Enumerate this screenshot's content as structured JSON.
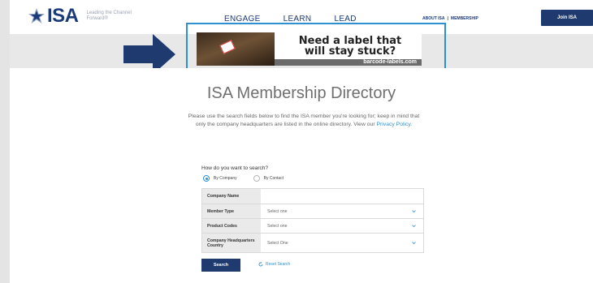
{
  "header": {
    "logo_text": "ISA",
    "tagline": "Leading the Channel Forward®",
    "nav": [
      "ENGAGE",
      "LEARN",
      "LEAD"
    ],
    "util_about": "ABOUT ISA",
    "util_sep": "|",
    "util_membership": "MEMBERSHIP",
    "join_label": "Join ISA"
  },
  "ad": {
    "headline_line1": "Need a label that",
    "headline_line2": "will stay stuck?",
    "url": "barcode-labels.com"
  },
  "main": {
    "title": "ISA Membership Directory",
    "intro_text": "Please use the search fields below to find the ISA member you're looking for; keep in mind that only the company headquarters are listed in the online directory. View our",
    "privacy_link": "Privacy Policy",
    "intro_end": "."
  },
  "search": {
    "question": "How do you want to search?",
    "radio_company": "By Company",
    "radio_contact": "By Contact",
    "selected": "By Company",
    "fields": [
      {
        "label": "Company Name",
        "value": ""
      },
      {
        "label": "Member Type",
        "value": "Select one"
      },
      {
        "label": "Product Codes",
        "value": "Select one"
      },
      {
        "label": "Company Headquarters Country",
        "value": "Select One"
      }
    ],
    "search_label": "Search",
    "reset_label": "Reset Search"
  },
  "colors": {
    "brand_navy": "#1e3a6f",
    "link_blue": "#2e90d0",
    "highlight_frame": "#2e90d0",
    "arrow": "#1e3a6f"
  }
}
